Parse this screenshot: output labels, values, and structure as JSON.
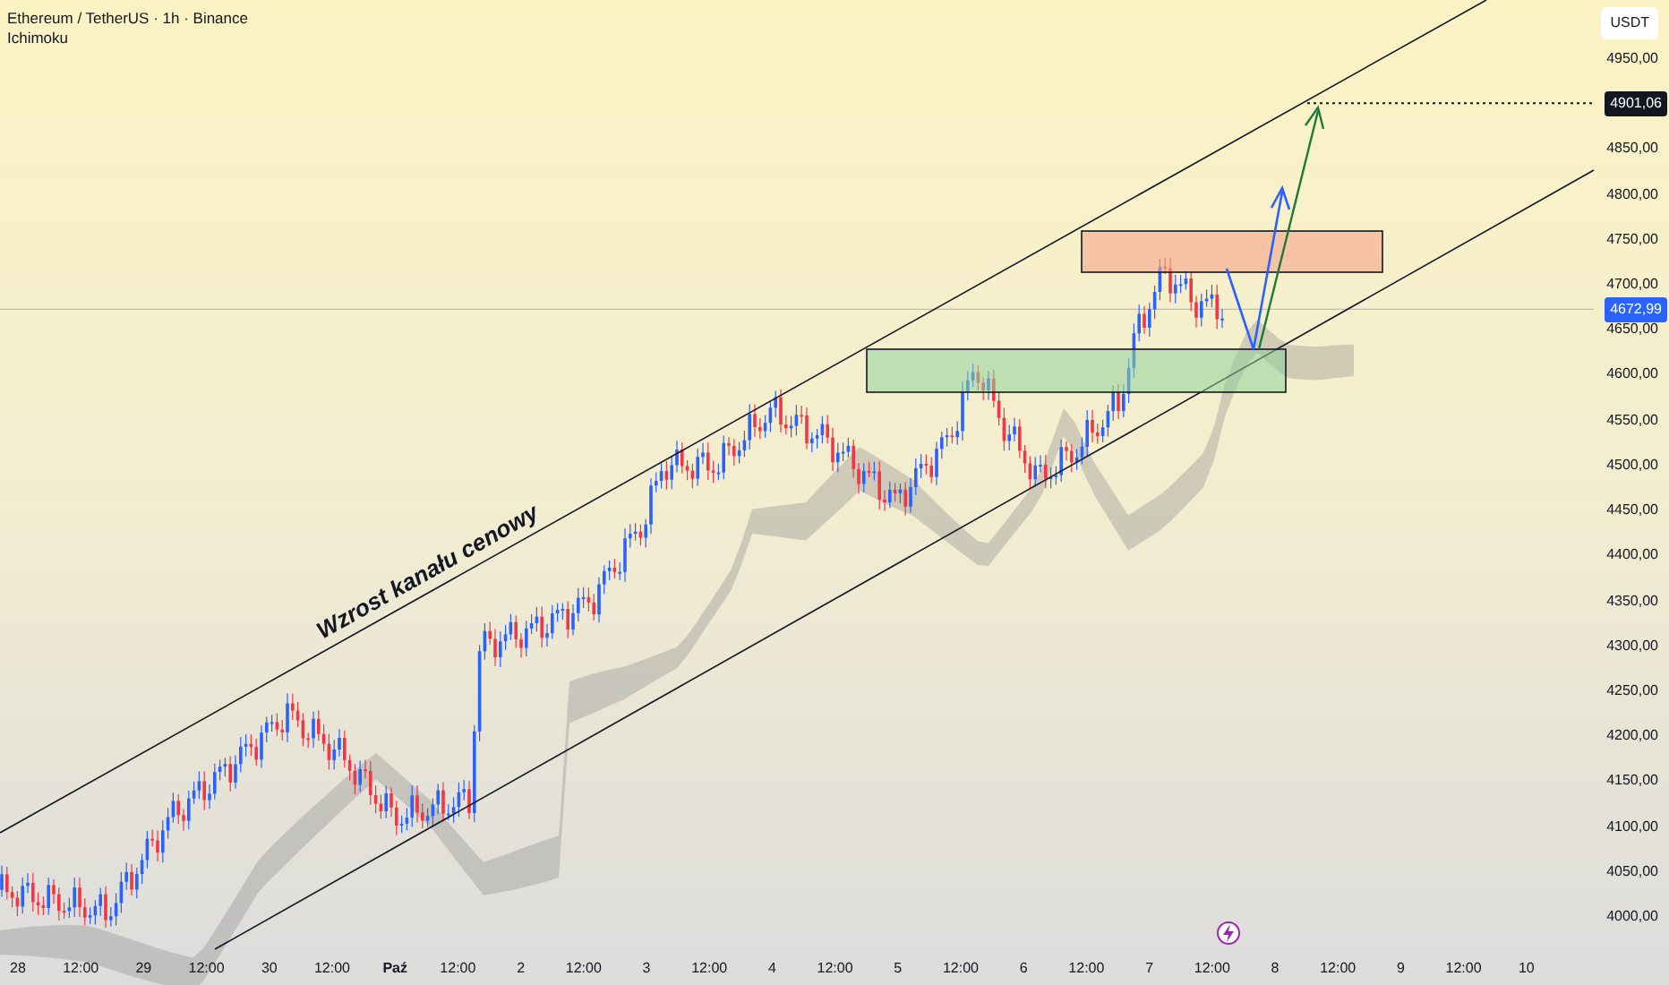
{
  "chart": {
    "title": "Ethereum / TetherUS · 1h · Binance",
    "indicator": "Ichimoku",
    "annotation": "Wzrost kanału cenowy",
    "currency": "USDT",
    "price_labels": [
      "4950,00",
      "4850,00",
      "4800,00",
      "4750,00",
      "4700,00",
      "4650,00",
      "4600,00",
      "4550,00",
      "4500,00",
      "4450,00",
      "4400,00",
      "4350,00",
      "4300,00",
      "4250,00",
      "4200,00",
      "4150,00",
      "4100,00",
      "4050,00",
      "4000,00"
    ],
    "last_price": "4672,99",
    "target_price": "4901,06",
    "time_labels": [
      "28",
      "12:00",
      "29",
      "12:00",
      "30",
      "12:00",
      "Paź",
      "12:00",
      "2",
      "12:00",
      "3",
      "12:00",
      "4",
      "12:00",
      "5",
      "12:00",
      "6",
      "12:00",
      "7",
      "12:00",
      "8",
      "12:00",
      "9",
      "12:00",
      "10"
    ]
  }
}
